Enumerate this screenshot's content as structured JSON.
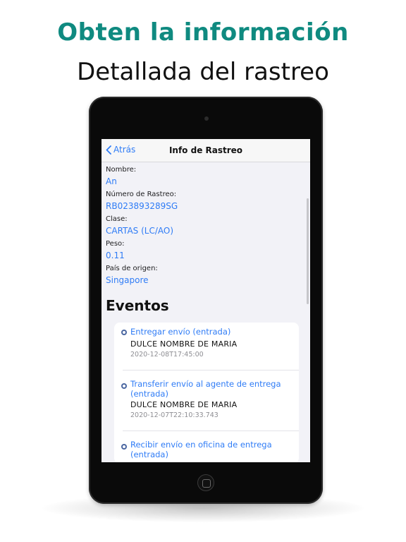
{
  "promo": {
    "headline": "Obten la información",
    "subheadline": "Detallada del rastreo"
  },
  "navbar": {
    "back_label": "Atrás",
    "title": "Info de Rastreo"
  },
  "details": [
    {
      "label": "Nombre:",
      "value": "An"
    },
    {
      "label": "Número de Rastreo:",
      "value": "RB023893289SG"
    },
    {
      "label": "Clase:",
      "value": "CARTAS (LC/AO)"
    },
    {
      "label": "Peso:",
      "value": "0.11"
    },
    {
      "label": "País de origen:",
      "value": "Singapore"
    }
  ],
  "events_section": {
    "title": "Eventos",
    "items": [
      {
        "title": "Entregar envío (entrada)",
        "place": "DULCE NOMBRE DE MARIA",
        "time": "2020-12-08T17:45:00"
      },
      {
        "title": "Transferir envío al agente de entrega (entrada)",
        "place": "DULCE NOMBRE DE MARIA",
        "time": "2020-12-07T22:10:33.743"
      },
      {
        "title": "Recibir envío en oficina de entrega (entrada)"
      }
    ]
  },
  "colors": {
    "headline": "#0f8a80",
    "link_blue": "#2f7cf6",
    "event_icon": "#4b67a1",
    "screen_bg": "#f2f2f7"
  },
  "icons": {
    "back": "chevron-left-icon",
    "event": "circle-dot-icon",
    "camera": "camera-dot",
    "home": "home-button"
  }
}
